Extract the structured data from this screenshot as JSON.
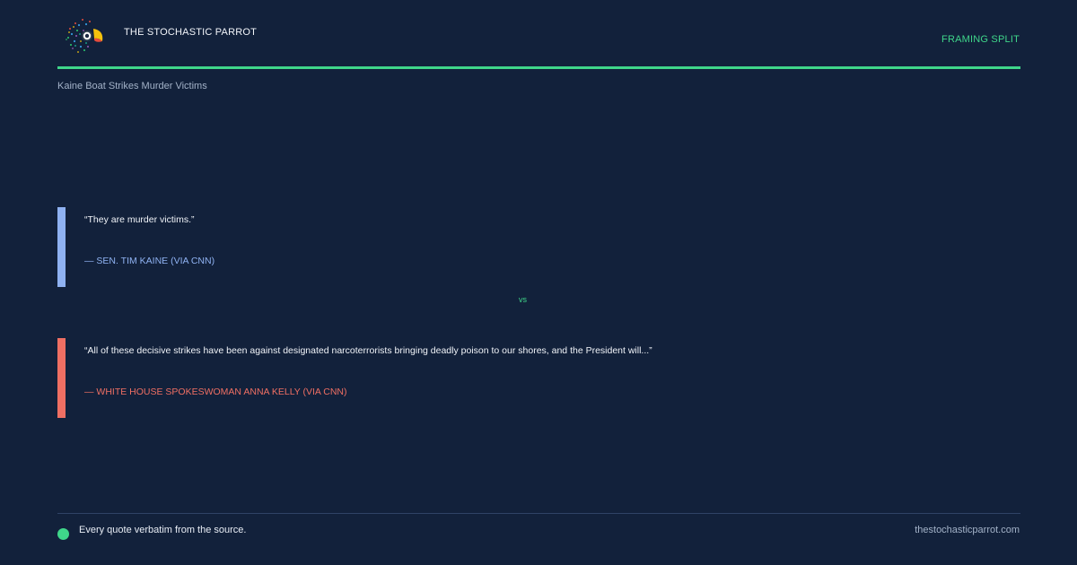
{
  "header": {
    "brand": "THE STOCHASTIC PARROT",
    "tag": "FRAMING SPLIT",
    "subtitle": "Kaine Boat Strikes Murder Victims",
    "logo_icon": "parrot-logo-icon"
  },
  "quotes": [
    {
      "text": "“They are murder victims.”",
      "attribution": "— SEN. TIM KAINE (VIA CNN)",
      "accent": "#8fb2f2"
    },
    {
      "text": "“All of these decisive strikes have been against designated narcoterrorists bringing deadly poison to our shores, and the President will...”",
      "attribution": "— WHITE HOUSE SPOKESWOMAN ANNA KELLY (VIA CNN)",
      "accent": "#ef6f63"
    }
  ],
  "divider": {
    "label": "vs"
  },
  "footer": {
    "note": "Every quote verbatim from the source.",
    "site": "thestochasticparrot.com"
  },
  "colors": {
    "background": "#12213b",
    "accent": "#3fd68a"
  }
}
